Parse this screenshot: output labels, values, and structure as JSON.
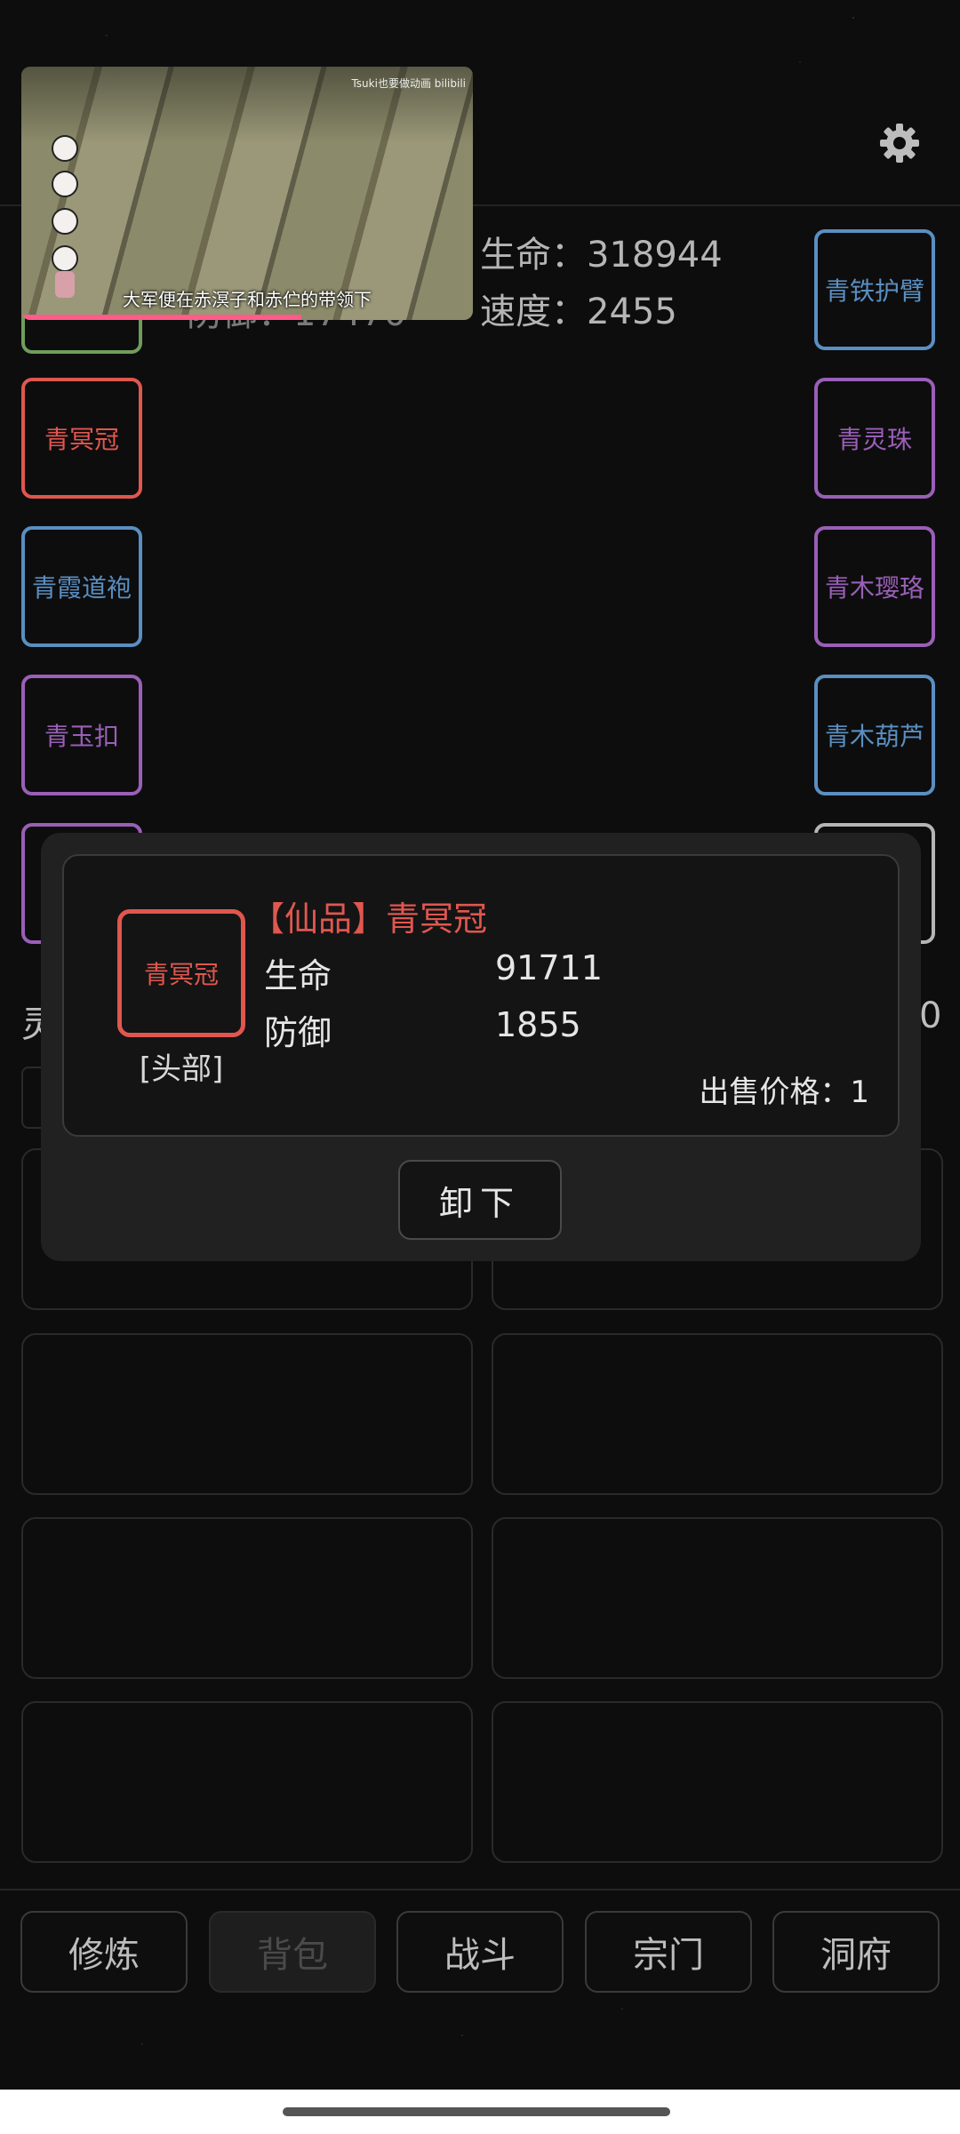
{
  "stats": {
    "life": "生命：318944",
    "speed": "速度：2455",
    "defense_partial": "防御：17470"
  },
  "equipment": {
    "left": [
      {
        "label": "",
        "color": "#6f9e5a"
      },
      {
        "label": "青冥冠",
        "color": "#e0574e"
      },
      {
        "label": "青霞道袍",
        "color": "#5a8fc1"
      },
      {
        "label": "青玉扣",
        "color": "#9a5fb7"
      },
      {
        "label": "",
        "color": "#9a5fb7"
      }
    ],
    "right": [
      {
        "label": "青铁护臂",
        "color": "#5a8fc1"
      },
      {
        "label": "青灵珠",
        "color": "#9a5fb7"
      },
      {
        "label": "青木璎珞",
        "color": "#9a5fb7"
      },
      {
        "label": "青木葫芦",
        "color": "#5a8fc1"
      },
      {
        "label": "",
        "color": "#b5b5b5"
      }
    ]
  },
  "video": {
    "subtitle": "大军便在赤溟子和赤伫的带领下",
    "watermark": "Tsuki也要做动画 bilibili"
  },
  "modal": {
    "item_icon_label": "青冥冠",
    "slot": "[头部]",
    "title": "【仙品】青冥冠",
    "attrs": [
      {
        "name": "生命",
        "value": "91711"
      },
      {
        "name": "防御",
        "value": "1855"
      }
    ],
    "price": "出售价格：1",
    "unequip": "卸下"
  },
  "partial": {
    "left_char": "灵",
    "right_char": "0"
  },
  "nav": [
    "修炼",
    "背包",
    "战斗",
    "宗门",
    "洞府"
  ]
}
